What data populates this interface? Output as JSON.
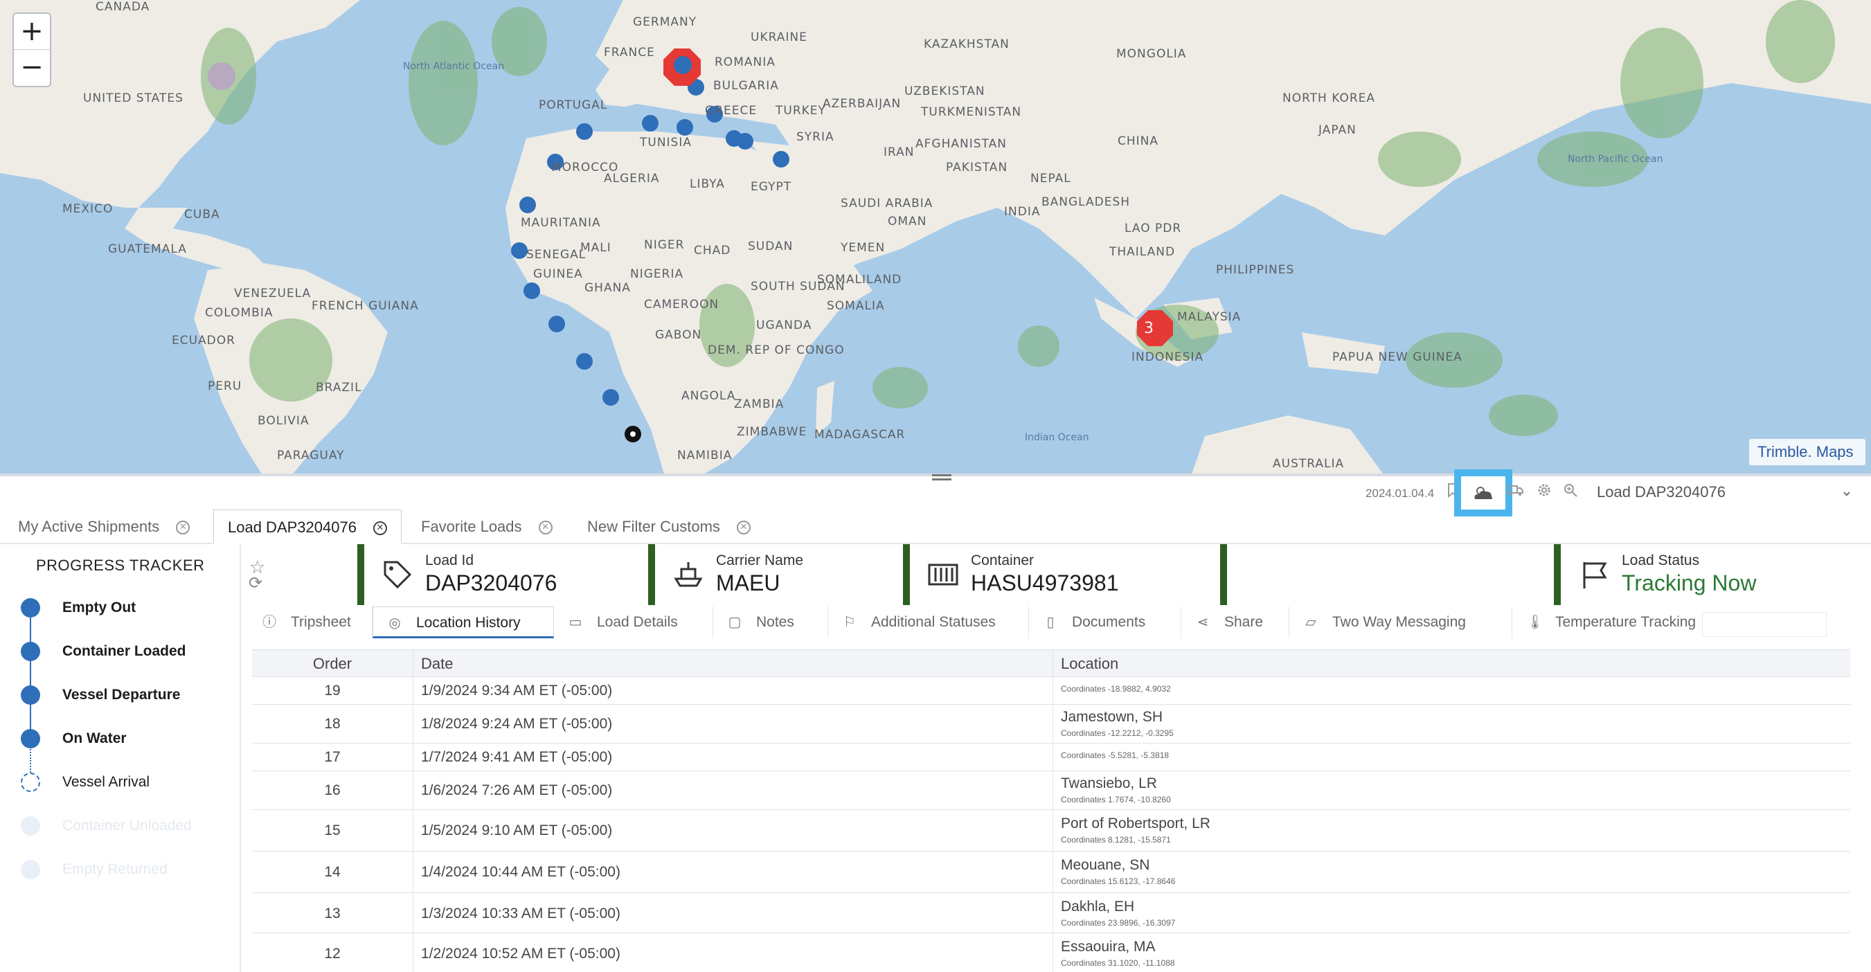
{
  "map": {
    "zoom_in": "+",
    "zoom_out": "−",
    "attribution": "Trimble. Maps",
    "cluster_count": "3",
    "labels": [
      "CANADA",
      "UNITED STATES",
      "MEXICO",
      "CUBA",
      "GUATEMALA",
      "VENEZUELA",
      "COLOMBIA",
      "ECUADOR",
      "PERU",
      "BRAZIL",
      "BOLIVIA",
      "PARAGUAY",
      "FRENCH GUIANA",
      "GERMANY",
      "FRANCE",
      "UKRAINE",
      "ROMANIA",
      "BULGARIA",
      "PORTUGAL",
      "GREECE",
      "TURKEY",
      "KAZAKHSTAN",
      "MONGOLIA",
      "UZBEKISTAN",
      "AZERBAIJAN",
      "TURKMENISTAN",
      "SYRIA",
      "IRAN",
      "AFGHANISTAN",
      "PAKISTAN",
      "NEPAL",
      "INDIA",
      "BANGLADESH",
      "CHINA",
      "NORTH KOREA",
      "JAPAN",
      "LAO PDR",
      "THAILAND",
      "PHILIPPINES",
      "MALAYSIA",
      "INDONESIA",
      "PAPUA NEW GUINEA",
      "AUSTRALIA",
      "TUNISIA",
      "MOROCCO",
      "ALGERIA",
      "LIBYA",
      "EGYPT",
      "SAUDI ARABIA",
      "OMAN",
      "YEMEN",
      "MAURITANIA",
      "MALI",
      "NIGER",
      "CHAD",
      "SUDAN",
      "SENEGAL",
      "GUINEA",
      "GHANA",
      "NIGERIA",
      "CAMEROON",
      "SOUTH SUDAN",
      "SOMALILAND",
      "SOMALIA",
      "UGANDA",
      "GABON",
      "DEM. REP OF CONGO",
      "ANGOLA",
      "ZAMBIA",
      "ZIMBABWE",
      "NAMIBIA",
      "MADAGASCAR"
    ],
    "oceans": [
      "North Atlantic Ocean",
      "North Pacific Ocean",
      "Indian Ocean"
    ]
  },
  "toolbar": {
    "version": "2024.01.04.4",
    "load_selector": "Load DAP3204076"
  },
  "tabs": [
    {
      "label": "My Active Shipments",
      "active": false
    },
    {
      "label": "Load DAP3204076",
      "active": true
    },
    {
      "label": "Favorite Loads",
      "active": false
    },
    {
      "label": "New Filter Customs",
      "active": false
    }
  ],
  "tracker": {
    "title": "PROGRESS TRACKER",
    "steps": [
      {
        "label": "Empty Out",
        "state": "done"
      },
      {
        "label": "Container Loaded",
        "state": "done"
      },
      {
        "label": "Vessel Departure",
        "state": "done"
      },
      {
        "label": "On Water",
        "state": "done"
      },
      {
        "label": "Vessel Arrival",
        "state": "current"
      },
      {
        "label": "Container Unloaded",
        "state": "pending"
      },
      {
        "label": "Empty Returned",
        "state": "pending"
      }
    ]
  },
  "summary": {
    "load_id": {
      "label": "Load Id",
      "value": "DAP3204076"
    },
    "carrier": {
      "label": "Carrier Name",
      "value": "MAEU"
    },
    "container": {
      "label": "Container",
      "value": "HASU4973981"
    },
    "status": {
      "label": "Load Status",
      "value": "Tracking Now",
      "color": "#2b7a35"
    }
  },
  "detail_tabs": [
    {
      "label": "Tripsheet",
      "icon": "info-icon"
    },
    {
      "label": "Location History",
      "icon": "location-target-icon",
      "active": true
    },
    {
      "label": "Load Details",
      "icon": "truck-icon"
    },
    {
      "label": "Notes",
      "icon": "note-icon"
    },
    {
      "label": "Additional Statuses",
      "icon": "flag-icon"
    },
    {
      "label": "Documents",
      "icon": "document-icon"
    },
    {
      "label": "Share",
      "icon": "share-icon"
    },
    {
      "label": "Two Way Messaging",
      "icon": "chat-icon"
    },
    {
      "label": "Temperature Tracking",
      "icon": "thermometer-icon"
    }
  ],
  "table": {
    "headers": {
      "order": "Order",
      "date": "Date",
      "location": "Location"
    },
    "rows": [
      {
        "order": "19",
        "date": "1/9/2024  9:34 AM  ET (-05:00)",
        "place": "",
        "coords": "Coordinates  -18.9882, 4.9032"
      },
      {
        "order": "18",
        "date": "1/8/2024  9:24 AM  ET (-05:00)",
        "place": "Jamestown, SH",
        "coords": "Coordinates  -12.2212, -0.3295"
      },
      {
        "order": "17",
        "date": "1/7/2024  9:41 AM  ET (-05:00)",
        "place": "",
        "coords": "Coordinates  -5.5281, -5.3818"
      },
      {
        "order": "16",
        "date": "1/6/2024  7:26 AM  ET (-05:00)",
        "place": "Twansiebo, LR",
        "coords": "Coordinates  1.7674, -10.8260"
      },
      {
        "order": "15",
        "date": "1/5/2024  9:10 AM  ET (-05:00)",
        "place": "Port of Robertsport, LR",
        "coords": "Coordinates  8.1281, -15.5871"
      },
      {
        "order": "14",
        "date": "1/4/2024  10:44 AM  ET (-05:00)",
        "place": "Meouane, SN",
        "coords": "Coordinates  15.6123, -17.8646"
      },
      {
        "order": "13",
        "date": "1/3/2024  10:33 AM  ET (-05:00)",
        "place": "Dakhla, EH",
        "coords": "Coordinates  23.9896, -16.3097"
      },
      {
        "order": "12",
        "date": "1/2/2024  10:52 AM  ET (-05:00)",
        "place": "Essaouira, MA",
        "coords": "Coordinates  31.1020, -11.1088"
      }
    ]
  },
  "colors": {
    "accent": "#2f6eb8",
    "card_bar": "#2d5f22",
    "highlight": "#4ab5ec",
    "marker_red": "#e53935"
  }
}
